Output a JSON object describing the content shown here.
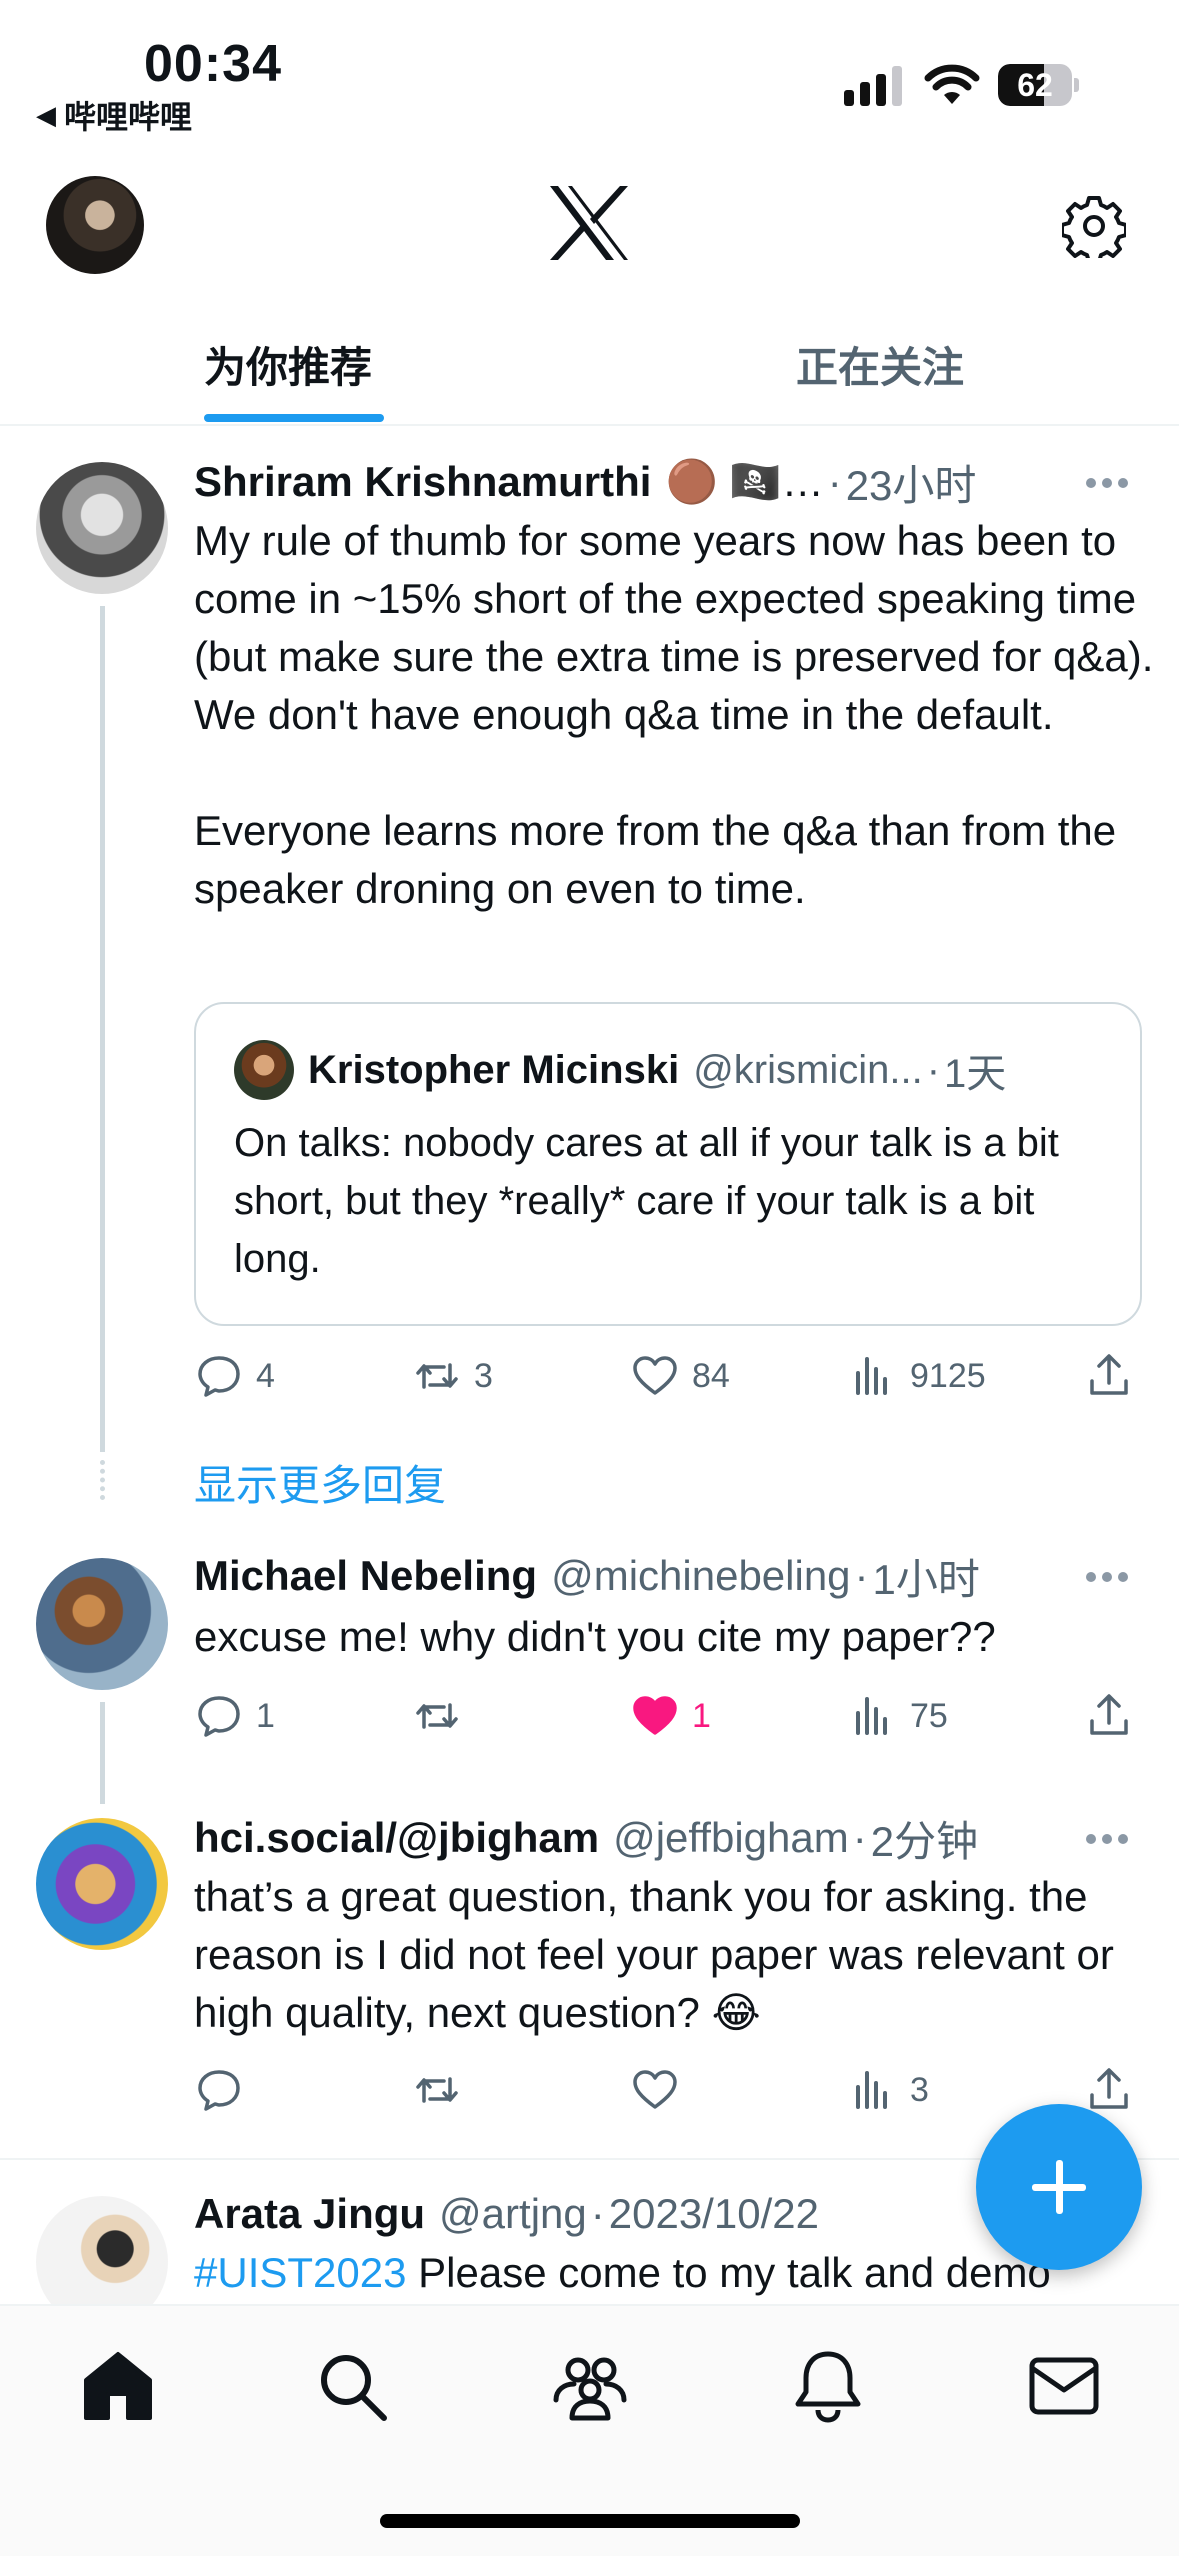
{
  "status_bar": {
    "time": "00:34",
    "back_app": "哔哩哔哩",
    "battery_percent": 62
  },
  "header": {
    "logo": "x-logo-icon",
    "settings_icon": "gear-icon"
  },
  "tabs": [
    {
      "label": "为你推荐",
      "active": true
    },
    {
      "label": "正在关注",
      "active": false
    }
  ],
  "tweets": [
    {
      "name": "Shriram Krishnamurthi",
      "name_suffix": "🟤 🏴‍☠️…",
      "handle": "",
      "time": "23小时",
      "text": "My rule of thumb for some years now has been to come in ~15% short of the expected speaking time (but make sure the extra time is preserved for q&a). We don't have enough q&a time in the default.\n\nEveryone learns more from the q&a than from the speaker droning on even to time.",
      "quote": {
        "name": "Kristopher Micinski",
        "handle": "@krismicin...",
        "time": "1天",
        "text": "On talks: nobody cares at all if your talk is a bit short, but they *really* care if your talk is a bit long."
      },
      "replies": "4",
      "retweets": "3",
      "likes": "84",
      "views": "9125"
    },
    {
      "name": "Michael Nebeling",
      "handle": "@michinebeling",
      "time": "1小时",
      "text": "excuse me! why didn't you cite my paper??",
      "replies": "1",
      "retweets": "",
      "likes": "1",
      "views": "75"
    },
    {
      "name": "hci.social/@jbigham",
      "handle": "@jeffbigham",
      "time": "2分钟",
      "text": "that’s a great question, thank you for asking. the reason is I did not feel your paper was relevant or high quality, next question? 😂",
      "replies": "",
      "retweets": "",
      "likes": "",
      "views": "3"
    },
    {
      "name": "Arata Jingu",
      "handle": "@artjng",
      "time": "2023/10/22",
      "hashtag": "#UIST2023",
      "text": " Please come to my talk and demo"
    }
  ],
  "show_more_replies": "显示更多回复",
  "bottom_nav": [
    "home-icon",
    "search-icon",
    "communities-icon",
    "notifications-icon",
    "messages-icon"
  ],
  "colors": {
    "accent": "#1d9bf0",
    "like": "#f91880",
    "secondary_text": "#536471"
  }
}
